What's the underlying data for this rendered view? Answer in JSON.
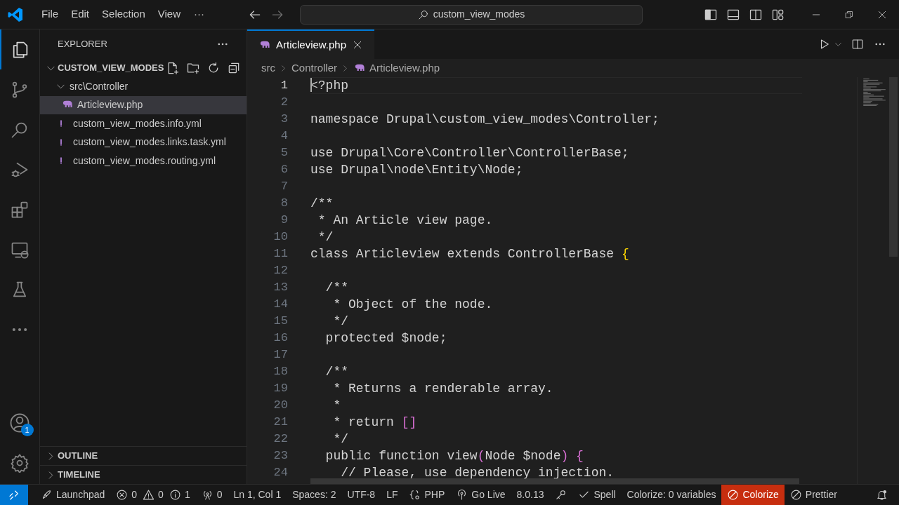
{
  "title_bar": {
    "menu": [
      "File",
      "Edit",
      "Selection",
      "View"
    ],
    "more": "···",
    "search": "custom_view_modes"
  },
  "activity_bar": {
    "items": [
      {
        "kind": "explorer",
        "selected": true
      },
      {
        "kind": "source-control",
        "selected": false
      },
      {
        "kind": "search",
        "selected": false
      },
      {
        "kind": "run-debug",
        "selected": false
      },
      {
        "kind": "extensions",
        "selected": false
      },
      {
        "kind": "remote",
        "selected": false
      },
      {
        "kind": "testing",
        "selected": false
      },
      {
        "kind": "more",
        "selected": false
      }
    ],
    "account_badge": "1"
  },
  "sidebar": {
    "title": "EXPLORER",
    "root": {
      "name": "CUSTOM_VIEW_MODES",
      "expanded": true,
      "children": [
        {
          "name": "src\\Controller",
          "kind": "folder",
          "expanded": true,
          "selected": false,
          "children": [
            {
              "name": "Articleview.php",
              "kind": "php",
              "selected": true
            }
          ]
        },
        {
          "name": "custom_view_modes.info.yml",
          "kind": "yml",
          "selected": false
        },
        {
          "name": "custom_view_modes.links.task.yml",
          "kind": "yml",
          "selected": false
        },
        {
          "name": "custom_view_modes.routing.yml",
          "kind": "yml",
          "selected": false
        }
      ]
    },
    "sections": [
      {
        "name": "OUTLINE",
        "expanded": false
      },
      {
        "name": "TIMELINE",
        "expanded": false
      }
    ]
  },
  "tabs": [
    {
      "label": "Articleview.php",
      "selected": true
    }
  ],
  "breadcrumb": [
    "src",
    "Controller",
    "Articleview.php"
  ],
  "editor": {
    "lines": [
      {
        "number": "1",
        "current": true,
        "tokens": [
          {
            "text": "<?php",
            "kind": "plain"
          }
        ]
      },
      {
        "number": "2",
        "current": false
      },
      {
        "number": "3",
        "current": false,
        "tokens": [
          {
            "text": "namespace Drupal\\custom_view_modes\\Controller;",
            "kind": "plain"
          }
        ]
      },
      {
        "number": "4",
        "current": false
      },
      {
        "number": "5",
        "current": false,
        "tokens": [
          {
            "text": "use Drupal\\Core\\Controller\\ControllerBase;",
            "kind": "plain"
          }
        ]
      },
      {
        "number": "6",
        "current": false,
        "tokens": [
          {
            "text": "use Drupal\\node\\Entity\\Node;",
            "kind": "plain"
          }
        ]
      },
      {
        "number": "7",
        "current": false
      },
      {
        "number": "8",
        "current": false,
        "tokens": [
          {
            "text": "/**",
            "kind": "plain"
          }
        ]
      },
      {
        "number": "9",
        "current": false,
        "tokens": [
          {
            "text": " * An Article view page.",
            "kind": "plain"
          }
        ]
      },
      {
        "number": "10",
        "current": false,
        "tokens": [
          {
            "text": " */",
            "kind": "plain"
          }
        ]
      },
      {
        "number": "11",
        "current": false,
        "tokens": [
          {
            "text": "class Articleview extends ControllerBase ",
            "kind": "plain"
          },
          {
            "text": "{",
            "kind": "bracket1"
          }
        ]
      },
      {
        "number": "12",
        "current": false
      },
      {
        "number": "13",
        "current": false,
        "tokens": [
          {
            "text": "  /**",
            "kind": "plain"
          }
        ]
      },
      {
        "number": "14",
        "current": false,
        "tokens": [
          {
            "text": "   * Object of the node.",
            "kind": "plain"
          }
        ]
      },
      {
        "number": "15",
        "current": false,
        "tokens": [
          {
            "text": "   */",
            "kind": "plain"
          }
        ]
      },
      {
        "number": "16",
        "current": false,
        "tokens": [
          {
            "text": "  protected $node;",
            "kind": "plain"
          }
        ]
      },
      {
        "number": "17",
        "current": false
      },
      {
        "number": "18",
        "current": false,
        "tokens": [
          {
            "text": "  /**",
            "kind": "plain"
          }
        ]
      },
      {
        "number": "19",
        "current": false,
        "tokens": [
          {
            "text": "   * Returns a renderable array.",
            "kind": "plain"
          }
        ]
      },
      {
        "number": "20",
        "current": false,
        "tokens": [
          {
            "text": "   *",
            "kind": "plain"
          }
        ]
      },
      {
        "number": "21",
        "current": false,
        "tokens": [
          {
            "text": "   * return ",
            "kind": "plain"
          },
          {
            "text": "[]",
            "kind": "bracket2"
          }
        ]
      },
      {
        "number": "22",
        "current": false,
        "tokens": [
          {
            "text": "   */",
            "kind": "plain"
          }
        ]
      },
      {
        "number": "23",
        "current": false,
        "tokens": [
          {
            "text": "  public function view",
            "kind": "plain"
          },
          {
            "text": "(",
            "kind": "bracket2"
          },
          {
            "text": "Node $node",
            "kind": "plain"
          },
          {
            "text": ") {",
            "kind": "bracket2"
          }
        ]
      },
      {
        "number": "24",
        "current": false,
        "tokens": [
          {
            "text": "    // Please, use dependency injection.",
            "kind": "plain"
          }
        ]
      }
    ]
  },
  "status_bar": {
    "items": [
      {
        "kind": "remote"
      },
      {
        "kind": "launchpad",
        "text": "Launchpad"
      },
      {
        "kind": "errors",
        "text": "0"
      },
      {
        "kind": "warnings",
        "text": "0"
      },
      {
        "kind": "info",
        "text": "1"
      },
      {
        "kind": "ports",
        "text": "0"
      },
      {
        "kind": "text",
        "text": "Ln 1, Col 1"
      },
      {
        "kind": "text",
        "text": "Spaces: 2"
      },
      {
        "kind": "text",
        "text": "UTF-8"
      },
      {
        "kind": "text",
        "text": "LF"
      },
      {
        "kind": "language",
        "text": "PHP"
      },
      {
        "kind": "golive",
        "text": "Go Live"
      },
      {
        "kind": "text",
        "text": "8.0.13"
      },
      {
        "kind": "key"
      },
      {
        "kind": "check",
        "text": "Spell"
      },
      {
        "kind": "text",
        "text": "Colorize: 0 variables"
      },
      {
        "kind": "alert",
        "text": "Colorize"
      },
      {
        "kind": "blocked",
        "text": "Prettier"
      },
      {
        "kind": "bell"
      }
    ]
  }
}
